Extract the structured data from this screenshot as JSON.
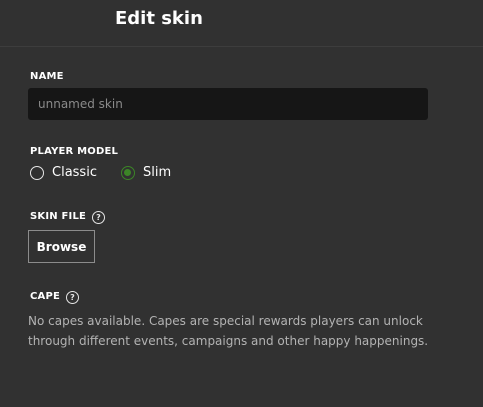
{
  "dialog": {
    "title": "Edit skin"
  },
  "name_section": {
    "label": "NAME",
    "value": "",
    "placeholder": "unnamed skin"
  },
  "player_model": {
    "label": "PLAYER MODEL",
    "options": [
      {
        "label": "Classic",
        "selected": false
      },
      {
        "label": "Slim",
        "selected": true
      }
    ]
  },
  "skin_file": {
    "label": "SKIN FILE",
    "help_glyph": "?",
    "browse_label": "Browse"
  },
  "cape": {
    "label": "CAPE",
    "help_glyph": "?",
    "message": "No capes available. Capes are special rewards players can unlock through different events, campaigns and other happy happenings."
  },
  "colors": {
    "background": "#313131",
    "input_background": "#161616",
    "accent_green": "#3c8527"
  }
}
